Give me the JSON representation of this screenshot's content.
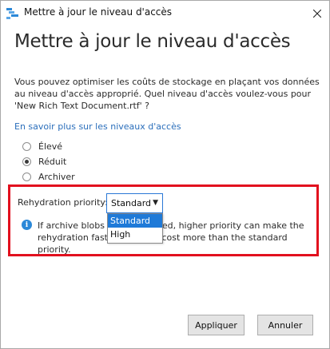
{
  "window": {
    "title": "Mettre à jour le niveau d'accès"
  },
  "dialog": {
    "heading": "Mettre à jour le niveau d'accès",
    "description": "Vous pouvez optimiser les coûts de stockage en plaçant vos données au niveau d'accès approprié. Quel niveau d'accès voulez-vous pour 'New Rich Text Document.rtf' ?",
    "learn_more_link": "En savoir plus sur les niveaux d'accès",
    "tiers": [
      {
        "label": "Élevé",
        "checked": false
      },
      {
        "label": "Réduit",
        "checked": true
      },
      {
        "label": "Archiver",
        "checked": false
      }
    ],
    "rehydration": {
      "label": "Rehydration priority:",
      "selected": "Standard",
      "options": [
        "Standard",
        "High"
      ],
      "info_text": "If archive blobs are rehydrated, higher priority can make the rehydration faster, but may cost more than the standard priority."
    }
  },
  "buttons": {
    "apply": "Appliquer",
    "cancel": "Annuler"
  },
  "colors": {
    "highlight": "#e2101e",
    "accent": "#1f7ad8",
    "link": "#2a6ebb"
  }
}
